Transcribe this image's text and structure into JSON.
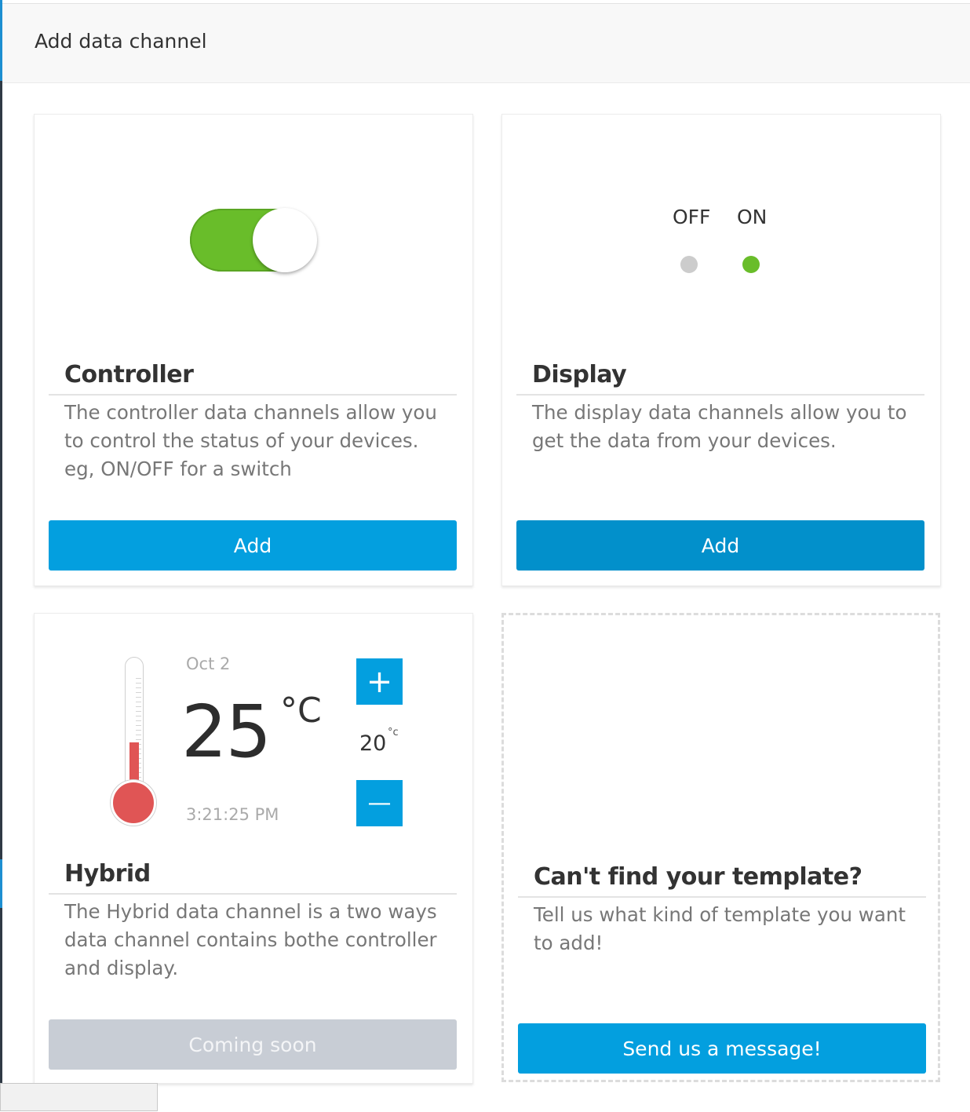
{
  "modal": {
    "title": "Add data channel"
  },
  "cards": {
    "controller": {
      "title": "Controller",
      "description": "The controller data channels allow you to control the status of your devices. eg, ON/OFF for a switch",
      "button_label": "Add",
      "toggle_state": "on",
      "toggle_color": "#69bd2a"
    },
    "display": {
      "title": "Display",
      "description": "The display data channels allow you to get the data from your devices.",
      "button_label": "Add",
      "off_label": "OFF",
      "on_label": "ON",
      "off_color": "#cccccc",
      "on_color": "#69bd2a"
    },
    "hybrid": {
      "title": "Hybrid",
      "description": "The Hybrid data channel is a two ways data channel contains bothe controller and display.",
      "button_label": "Coming soon",
      "widget": {
        "date": "Oct 2",
        "temperature": "25",
        "unit": "°C",
        "time": "3:21:25 PM",
        "setpoint": "20",
        "setpoint_unit": "°c",
        "plus_label": "+",
        "minus_label": "—",
        "thermometer_color": "#e05555"
      }
    },
    "request": {
      "title": "Can't find your template?",
      "description": "Tell us what kind of template you want to add!",
      "button_label": "Send us a message!"
    }
  },
  "colors": {
    "primary": "#039fdf",
    "primary_hover": "#0290cb",
    "disabled": "#c8cdd5"
  }
}
